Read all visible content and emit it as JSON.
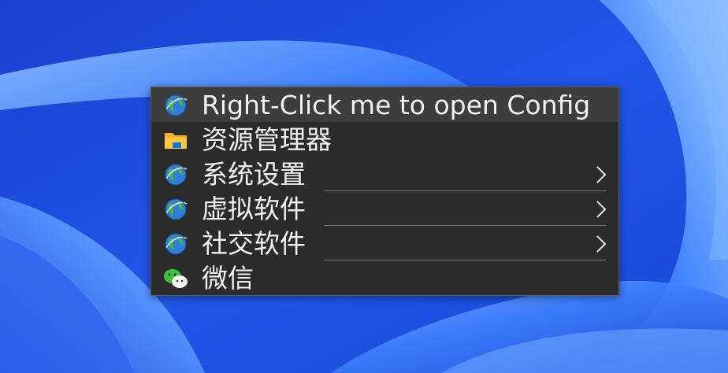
{
  "desktop": {
    "background_color": "#1f4fe0",
    "wallpaper": "windows-11-bloom"
  },
  "context_menu": {
    "items": [
      {
        "label": "Right-Click me to open Config",
        "icon": "globe-icon",
        "has_submenu": false,
        "highlighted": true
      },
      {
        "label": "资源管理器",
        "icon": "folder-icon",
        "has_submenu": false,
        "highlighted": false
      },
      {
        "label": "系统设置",
        "icon": "globe-icon",
        "has_submenu": true,
        "highlighted": false
      },
      {
        "label": "虚拟软件",
        "icon": "globe-icon",
        "has_submenu": true,
        "highlighted": false
      },
      {
        "label": "社交软件",
        "icon": "globe-icon",
        "has_submenu": true,
        "highlighted": false
      },
      {
        "label": "微信",
        "icon": "wechat-icon",
        "has_submenu": false,
        "highlighted": false
      }
    ],
    "colors": {
      "background": "#2b2b2b",
      "highlight": "#3d3d3d",
      "text": "#f2f2f2",
      "separator": "#7a7a7a"
    }
  }
}
